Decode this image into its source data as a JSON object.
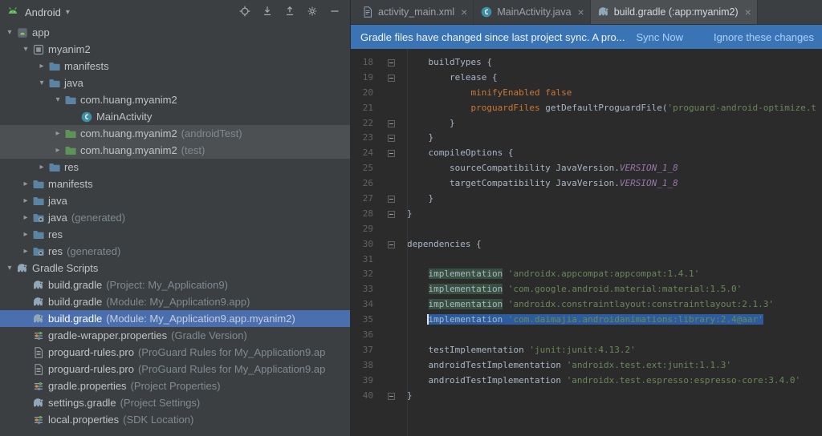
{
  "colors": {
    "panel_bg": "#3c3f41",
    "editor_bg": "#2b2b2b",
    "tree_selection_active": "#4b6eaf",
    "tree_selection_inactive": "#4d5052",
    "banner_bg": "#3b74b5",
    "banner_link": "#a8d2ff",
    "code_keyword": "#cc7832",
    "code_string": "#6a8759",
    "code_constant": "#9876aa",
    "editor_selection": "#2d5c9e",
    "occurrence_highlight": "#38503f"
  },
  "project_panel": {
    "header": {
      "title": "Android"
    },
    "toolbar": [
      {
        "name": "locate-file",
        "icon": "locate"
      },
      {
        "name": "expand-all",
        "icon": "expand-all"
      },
      {
        "name": "collapse-all",
        "icon": "collapse-all"
      },
      {
        "name": "settings",
        "icon": "gear"
      },
      {
        "name": "hide-panel",
        "icon": "hide"
      }
    ],
    "rows": [
      {
        "label": "app",
        "indent": 0,
        "chevron": "down",
        "icon": "app-module"
      },
      {
        "label": "myanim2",
        "indent": 1,
        "chevron": "down",
        "icon": "module"
      },
      {
        "label": "manifests",
        "indent": 2,
        "chevron": "right",
        "icon": "folder"
      },
      {
        "label": "java",
        "indent": 2,
        "chevron": "down",
        "icon": "folder"
      },
      {
        "label": "com.huang.myanim2",
        "indent": 3,
        "chevron": "down",
        "icon": "folder"
      },
      {
        "label": "MainActivity",
        "indent": 4,
        "chevron": "none",
        "icon": "class"
      },
      {
        "label": "com.huang.myanim2",
        "suffix": "(androidTest)",
        "indent": 3,
        "chevron": "right",
        "icon": "folder-test",
        "selected": "inactive"
      },
      {
        "label": "com.huang.myanim2",
        "suffix": "(test)",
        "indent": 3,
        "chevron": "right",
        "icon": "folder-test",
        "selected": "inactive"
      },
      {
        "label": "res",
        "indent": 2,
        "chevron": "right",
        "icon": "folder"
      },
      {
        "label": "manifests",
        "indent": 1,
        "chevron": "right",
        "icon": "folder"
      },
      {
        "label": "java",
        "indent": 1,
        "chevron": "right",
        "icon": "folder"
      },
      {
        "label": "java",
        "suffix": "(generated)",
        "indent": 1,
        "chevron": "right",
        "icon": "folder-gen"
      },
      {
        "label": "res",
        "indent": 1,
        "chevron": "right",
        "icon": "folder"
      },
      {
        "label": "res",
        "suffix": "(generated)",
        "indent": 1,
        "chevron": "right",
        "icon": "folder-gen"
      },
      {
        "label": "Gradle Scripts",
        "indent": 0,
        "chevron": "down",
        "icon": "gradle"
      },
      {
        "label": "build.gradle",
        "suffix": "(Project: My_Application9)",
        "indent": 1,
        "chevron": "none",
        "icon": "gradle"
      },
      {
        "label": "build.gradle",
        "suffix": "(Module: My_Application9.app)",
        "indent": 1,
        "chevron": "none",
        "icon": "gradle"
      },
      {
        "label": "build.gradle",
        "suffix": "(Module: My_Application9.app.myanim2)",
        "indent": 1,
        "chevron": "none",
        "icon": "gradle",
        "selected": "active"
      },
      {
        "label": "gradle-wrapper.properties",
        "suffix": "(Gradle Version)",
        "indent": 1,
        "chevron": "none",
        "icon": "properties"
      },
      {
        "label": "proguard-rules.pro",
        "suffix": "(ProGuard Rules for My_Application9.ap",
        "indent": 1,
        "chevron": "none",
        "icon": "text-file"
      },
      {
        "label": "proguard-rules.pro",
        "suffix": "(ProGuard Rules for My_Application9.ap",
        "indent": 1,
        "chevron": "none",
        "icon": "text-file"
      },
      {
        "label": "gradle.properties",
        "suffix": "(Project Properties)",
        "indent": 1,
        "chevron": "none",
        "icon": "properties"
      },
      {
        "label": "settings.gradle",
        "suffix": "(Project Settings)",
        "indent": 1,
        "chevron": "none",
        "icon": "gradle"
      },
      {
        "label": "local.properties",
        "suffix": "(SDK Location)",
        "indent": 1,
        "chevron": "none",
        "icon": "properties"
      }
    ]
  },
  "tabs": [
    {
      "label": "activity_main.xml",
      "icon": "layout-file",
      "active": false
    },
    {
      "label": "MainActivity.java",
      "icon": "class",
      "active": false
    },
    {
      "label": "build.gradle (:app:myanim2)",
      "icon": "gradle",
      "active": true
    }
  ],
  "banner": {
    "message": "Gradle files have changed since last project sync. A pro...",
    "actions": [
      "Sync Now",
      "Ignore these changes"
    ]
  },
  "editor": {
    "file": "build.gradle",
    "lines": [
      {
        "num": 18,
        "fold": true,
        "tokens": [
          {
            "text": "    buildTypes {"
          }
        ]
      },
      {
        "num": 19,
        "fold": true,
        "tokens": [
          {
            "text": "        release {"
          }
        ]
      },
      {
        "num": 20,
        "fold": false,
        "tokens": [
          {
            "text": "            "
          },
          {
            "text": "minifyEnabled",
            "color": "kw"
          },
          {
            "text": " "
          },
          {
            "text": "false",
            "color": "kw"
          }
        ]
      },
      {
        "num": 21,
        "fold": false,
        "tokens": [
          {
            "text": "            "
          },
          {
            "text": "proguardFiles",
            "color": "kw"
          },
          {
            "text": " getDefaultProguardFile("
          },
          {
            "text": "'proguard-android-optimize.t",
            "color": "str"
          }
        ]
      },
      {
        "num": 22,
        "fold": true,
        "tokens": [
          {
            "text": "        }"
          }
        ]
      },
      {
        "num": 23,
        "fold": true,
        "tokens": [
          {
            "text": "    }"
          }
        ]
      },
      {
        "num": 24,
        "fold": true,
        "tokens": [
          {
            "text": "    compileOptions {"
          }
        ]
      },
      {
        "num": 25,
        "fold": false,
        "tokens": [
          {
            "text": "        sourceCompatibility JavaVersion."
          },
          {
            "text": "VERSION_1_8",
            "color": "const"
          }
        ]
      },
      {
        "num": 26,
        "fold": false,
        "tokens": [
          {
            "text": "        targetCompatibility JavaVersion."
          },
          {
            "text": "VERSION_1_8",
            "color": "const"
          }
        ]
      },
      {
        "num": 27,
        "fold": true,
        "tokens": [
          {
            "text": "    }"
          }
        ]
      },
      {
        "num": 28,
        "fold": true,
        "tokens": [
          {
            "text": "}"
          }
        ]
      },
      {
        "num": 29,
        "fold": false,
        "tokens": []
      },
      {
        "num": 30,
        "fold": true,
        "tokens": [
          {
            "text": "dependencies {"
          }
        ]
      },
      {
        "num": 31,
        "fold": false,
        "tokens": []
      },
      {
        "num": 32,
        "fold": false,
        "tokens": [
          {
            "text": "    "
          },
          {
            "text": "implementation",
            "hl": true
          },
          {
            "text": " "
          },
          {
            "text": "'androidx.appcompat:appcompat:1.4.1'",
            "color": "str"
          }
        ]
      },
      {
        "num": 33,
        "fold": false,
        "tokens": [
          {
            "text": "    "
          },
          {
            "text": "implementation",
            "hl": true
          },
          {
            "text": " "
          },
          {
            "text": "'com.google.android.material:material:1.5.0'",
            "color": "str"
          }
        ]
      },
      {
        "num": 34,
        "fold": false,
        "tokens": [
          {
            "text": "    "
          },
          {
            "text": "implementation",
            "hl": true
          },
          {
            "text": " "
          },
          {
            "text": "'androidx.constraintlayout:constraintlayout:2.1.3'",
            "color": "str"
          }
        ]
      },
      {
        "num": 35,
        "fold": false,
        "tokens": [
          {
            "text": "    "
          },
          {
            "text": "implementation",
            "sel": true,
            "caret": true
          },
          {
            "text": " ",
            "sel": true
          },
          {
            "text": "'com.daimajia.androidanimations:library:2.4@aar'",
            "color": "str",
            "sel": true
          }
        ]
      },
      {
        "num": 36,
        "fold": false,
        "tokens": []
      },
      {
        "num": 37,
        "fold": false,
        "tokens": [
          {
            "text": "    testImplementation "
          },
          {
            "text": "'junit:junit:4.13.2'",
            "color": "str"
          }
        ]
      },
      {
        "num": 38,
        "fold": false,
        "tokens": [
          {
            "text": "    androidTestImplementation "
          },
          {
            "text": "'androidx.test.ext:junit:1.1.3'",
            "color": "str"
          }
        ]
      },
      {
        "num": 39,
        "fold": false,
        "tokens": [
          {
            "text": "    androidTestImplementation "
          },
          {
            "text": "'androidx.test.espresso:espresso-core:3.4.0'",
            "color": "str"
          }
        ]
      },
      {
        "num": 40,
        "fold": true,
        "tokens": [
          {
            "text": "}"
          }
        ]
      }
    ]
  }
}
